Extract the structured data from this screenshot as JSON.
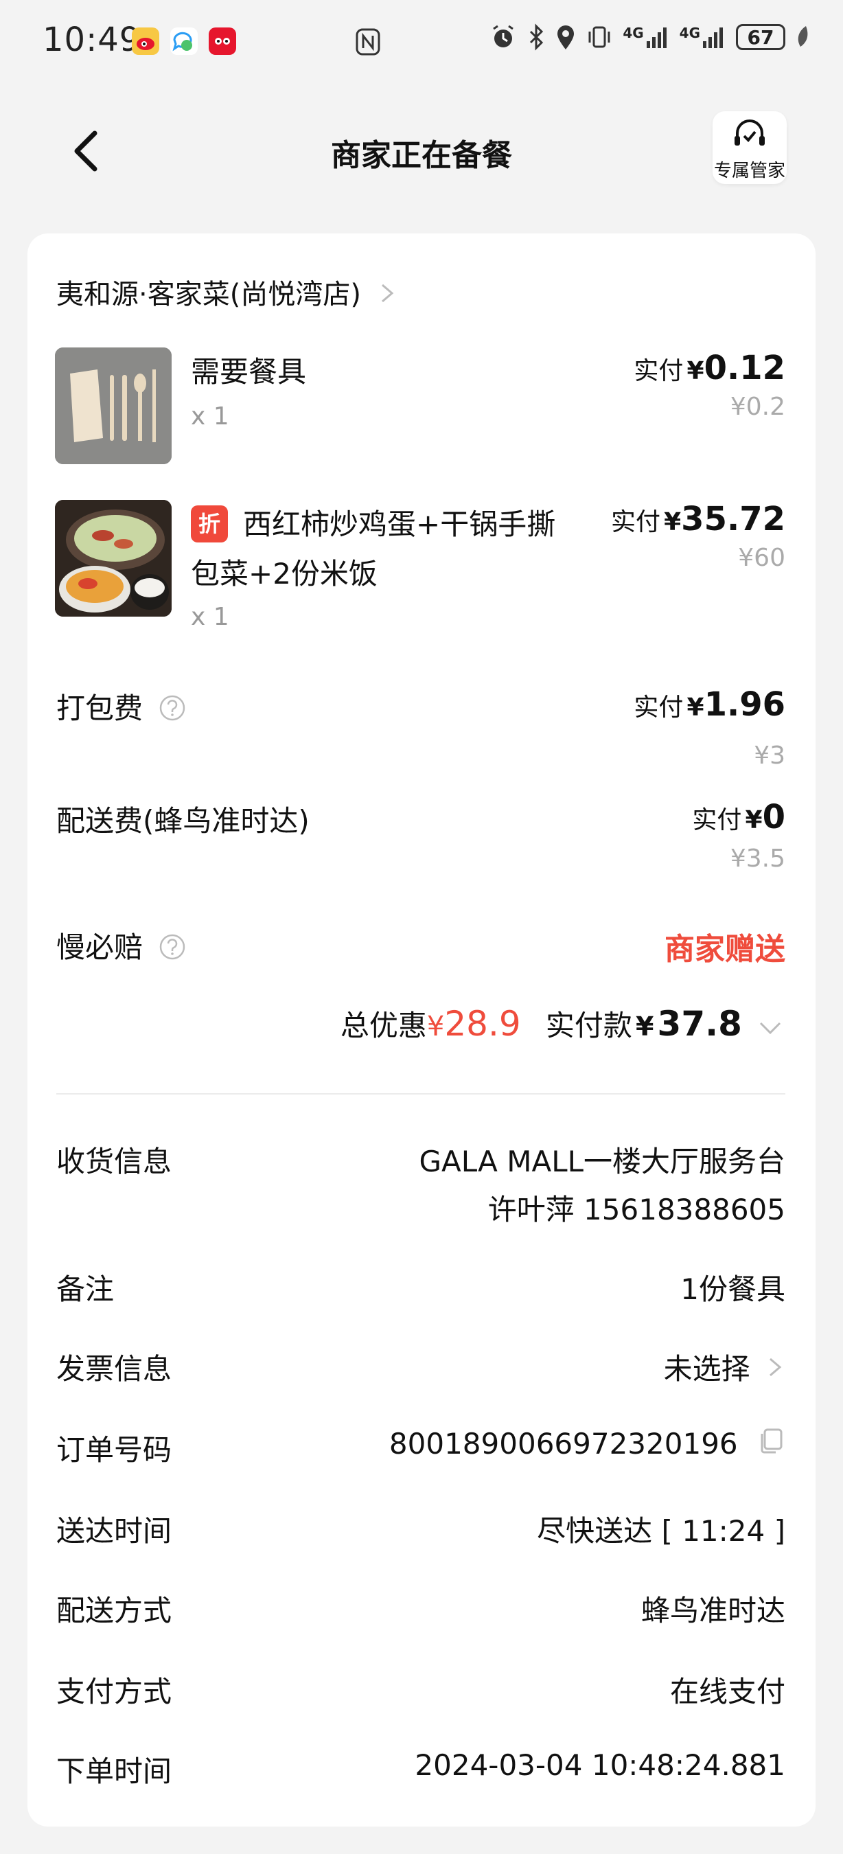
{
  "status_bar": {
    "time": "10:49",
    "battery": "67",
    "network_labels": [
      "4G",
      "4G"
    ]
  },
  "header": {
    "title": "商家正在备餐",
    "concierge_label": "专属管家"
  },
  "order": {
    "shop_name": "夷和源·客家菜(尚悦湾店)",
    "items": [
      {
        "name": "需要餐具",
        "qty": "x 1",
        "paid_label": "实付",
        "yen": "¥",
        "paid": "0.12",
        "original": "¥0.2"
      },
      {
        "discount_tag": "折",
        "name_line1": "西红柿炒鸡蛋+干锅手撕",
        "name_line2": "包菜+2份米饭",
        "qty": "x 1",
        "paid_label": "实付",
        "yen": "¥",
        "paid": "35.72",
        "original": "¥60"
      }
    ],
    "fees": [
      {
        "label": "打包费",
        "paid_label": "实付",
        "yen": "¥",
        "paid": "1.96",
        "original": "¥3"
      },
      {
        "label": "配送费(蜂鸟准时达)",
        "paid_label": "实付",
        "yen": "¥",
        "paid": "0",
        "original": "¥3.5"
      }
    ],
    "slow_compensation": {
      "label": "慢必赔",
      "value": "商家赠送"
    },
    "summary": {
      "discount_label": "总优惠",
      "discount_yen": "¥",
      "discount_value": "28.9",
      "total_label": "实付款",
      "total_yen": "¥",
      "total_value": "37.8"
    }
  },
  "info": [
    {
      "label": "收货信息",
      "value_line1": "GALA MALL一楼大厅服务台",
      "value_line2": "许叶萍 15618388605"
    },
    {
      "label": "备注",
      "value": "1份餐具"
    },
    {
      "label": "发票信息",
      "value": "未选择"
    },
    {
      "label": "订单号码",
      "value": "8001890066972320196"
    },
    {
      "label": "送达时间",
      "value": "尽快送达 [ 11:24 ]"
    },
    {
      "label": "配送方式",
      "value": "蜂鸟准时达"
    },
    {
      "label": "支付方式",
      "value": "在线支付"
    },
    {
      "label": "下单时间",
      "value": "2024-03-04 10:48:24.881"
    }
  ],
  "colors": {
    "accent_red": "#ef4c3c",
    "discount_tag": "#f0493b",
    "background": "#f3f3f3",
    "muted_text": "#aaaaaa"
  },
  "icons": [
    "back-arrow-icon",
    "headset-icon",
    "chevron-right-icon",
    "help-circle-icon",
    "chevron-down-icon",
    "copy-icon"
  ]
}
